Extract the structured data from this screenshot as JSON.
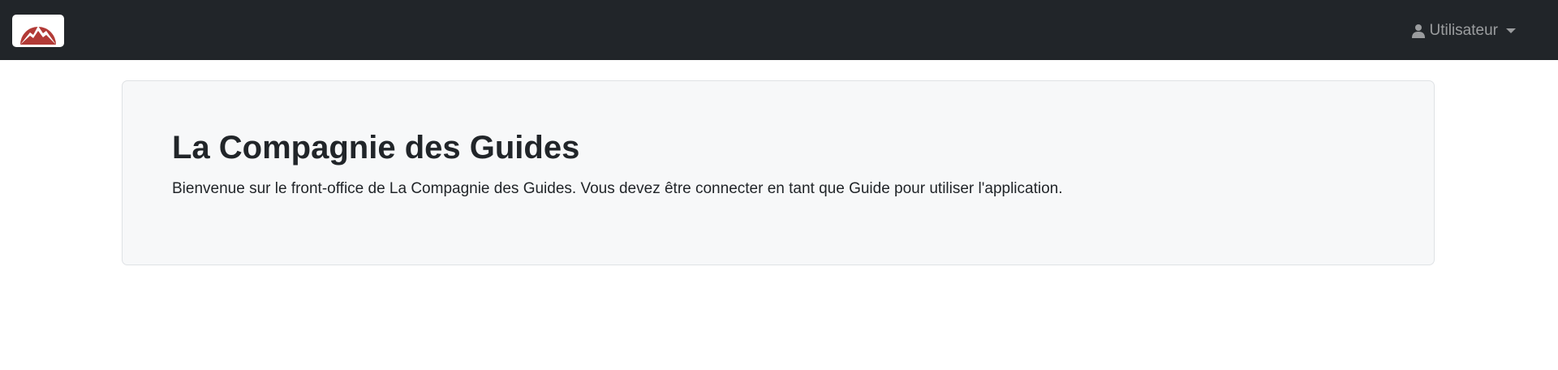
{
  "navbar": {
    "logo_icon": "mountain-logo-icon",
    "user_menu": {
      "icon": "user-icon",
      "label": "Utilisateur",
      "caret_icon": "caret-down-icon"
    }
  },
  "main": {
    "title": "La Compagnie des Guides",
    "lead": "Bienvenue sur le front-office de La Compagnie des Guides. Vous devez être connecter en tant que Guide pour utiliser l'application."
  },
  "colors": {
    "navbar_bg": "#212529",
    "logo_red": "#b23a36",
    "jumbotron_bg": "#f7f8f9",
    "text": "#212529"
  }
}
